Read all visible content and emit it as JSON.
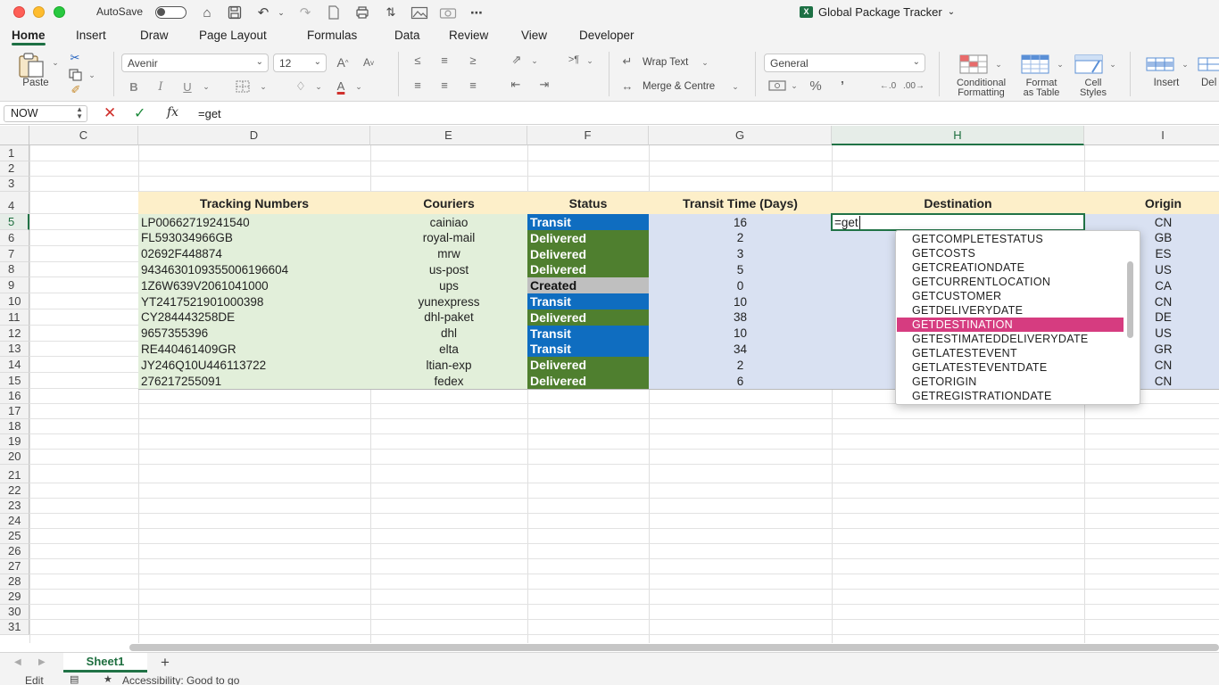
{
  "window": {
    "title": "Global Package Tracker",
    "autosave_label": "AutoSave"
  },
  "menu_tabs": [
    {
      "label": "Home",
      "active": true
    },
    {
      "label": "Insert"
    },
    {
      "label": "Draw"
    },
    {
      "label": "Page Layout"
    },
    {
      "label": "Formulas"
    },
    {
      "label": "Data"
    },
    {
      "label": "Review"
    },
    {
      "label": "View"
    },
    {
      "label": "Developer"
    }
  ],
  "ribbon": {
    "paste_label": "Paste",
    "font_name": "Avenir",
    "font_size": "12",
    "wrap_text_label": "Wrap Text",
    "merge_label": "Merge & Centre",
    "number_format": "General",
    "conditional_formatting_label_1": "Conditional",
    "conditional_formatting_label_2": "Formatting",
    "format_table_label_1": "Format",
    "format_table_label_2": "as Table",
    "cell_styles_label_1": "Cell",
    "cell_styles_label_2": "Styles",
    "insert_label": "Insert",
    "delete_label": "Del"
  },
  "formula_bar": {
    "name_box": "NOW",
    "formula": "=get"
  },
  "columns": [
    "C",
    "D",
    "E",
    "F",
    "G",
    "H",
    "I"
  ],
  "selected_column": "H",
  "rows": [
    "1",
    "2",
    "3",
    "4",
    "5",
    "6",
    "7",
    "8",
    "9",
    "10",
    "11",
    "12",
    "13",
    "14",
    "15",
    "16",
    "17",
    "18",
    "19",
    "20",
    "21",
    "22",
    "23",
    "24",
    "25",
    "26",
    "27",
    "28",
    "29",
    "30",
    "31"
  ],
  "selected_row": "5",
  "table": {
    "headers": [
      "Tracking Numbers",
      "Couriers",
      "Status",
      "Transit Time (Days)",
      "Destination",
      "Origin"
    ],
    "rows": [
      {
        "tracking": "LP00662719241540",
        "courier": "cainiao",
        "status": "Transit",
        "days": "16",
        "origin": "CN"
      },
      {
        "tracking": "FL593034966GB",
        "courier": "royal-mail",
        "status": "Delivered",
        "days": "2",
        "origin": "GB"
      },
      {
        "tracking": "02692F448874",
        "courier": "mrw",
        "status": "Delivered",
        "days": "3",
        "origin": "ES"
      },
      {
        "tracking": "9434630109355006196604",
        "courier": "us-post",
        "status": "Delivered",
        "days": "5",
        "origin": "US"
      },
      {
        "tracking": "1Z6W639V2061041000",
        "courier": "ups",
        "status": "Created",
        "days": "0",
        "origin": "CA"
      },
      {
        "tracking": "YT2417521901000398",
        "courier": "yunexpress",
        "status": "Transit",
        "days": "10",
        "origin": "CN"
      },
      {
        "tracking": "CY284443258DE",
        "courier": "dhl-paket",
        "status": "Delivered",
        "days": "38",
        "origin": "DE"
      },
      {
        "tracking": "9657355396",
        "courier": "dhl",
        "status": "Transit",
        "days": "10",
        "origin": "US"
      },
      {
        "tracking": "RE440461409GR",
        "courier": "elta",
        "status": "Transit",
        "days": "34",
        "origin": "GR"
      },
      {
        "tracking": "JY246Q10U446113722",
        "courier": "ltian-exp",
        "status": "Delivered",
        "days": "2",
        "origin": "CN"
      },
      {
        "tracking": "276217255091",
        "courier": "fedex",
        "status": "Delivered",
        "days": "6",
        "origin": "CN"
      }
    ]
  },
  "active_cell_text": "=get",
  "autocomplete": {
    "items": [
      "GETCOMPLETESTATUS",
      "GETCOSTS",
      "GETCREATIONDATE",
      "GETCURRENTLOCATION",
      "GETCUSTOMER",
      "GETDELIVERYDATE",
      "GETDESTINATION",
      "GETESTIMATEDDELIVERYDATE",
      "GETLATESTEVENT",
      "GETLATESTEVENTDATE",
      "GETORIGIN",
      "GETREGISTRATIONDATE"
    ],
    "highlighted": "GETDESTINATION"
  },
  "sheets": [
    {
      "name": "Sheet1",
      "active": true
    }
  ],
  "status_bar": {
    "mode": "Edit",
    "accessibility": "Accessibility: Good to go"
  },
  "colors": {
    "accent": "#217346",
    "transit": "#0f6dc0",
    "delivered": "#4f7f2f",
    "created": "#bfbfbf",
    "header_fill": "#fdefc9",
    "green_fill": "#e2efda",
    "blue_fill": "#d9e1f2",
    "autocomplete_highlight": "#d63c80"
  }
}
